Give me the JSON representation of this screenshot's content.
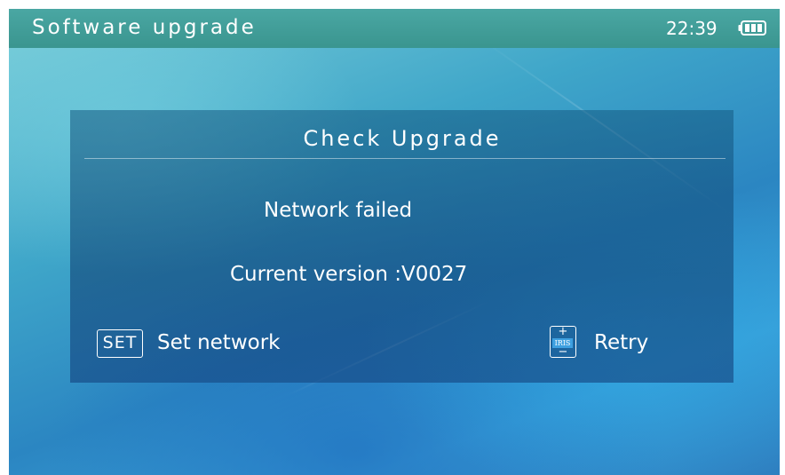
{
  "header": {
    "title": "Software upgrade",
    "time": "22:39",
    "battery_icon": "battery-full-icon"
  },
  "dialog": {
    "title": "Check Upgrade",
    "status": "Network failed",
    "version_label": "Current version :",
    "version_value": "V0027",
    "actions": [
      {
        "key": "SET",
        "label": "Set network"
      },
      {
        "key_top": "+",
        "key_text": "IRIS",
        "key_bottom": "−",
        "label": "Retry"
      }
    ]
  },
  "colors": {
    "topbar": "#3a958f",
    "background_accent": "#2b86c2",
    "dialog": "#145a82",
    "text": "#ffffff"
  }
}
